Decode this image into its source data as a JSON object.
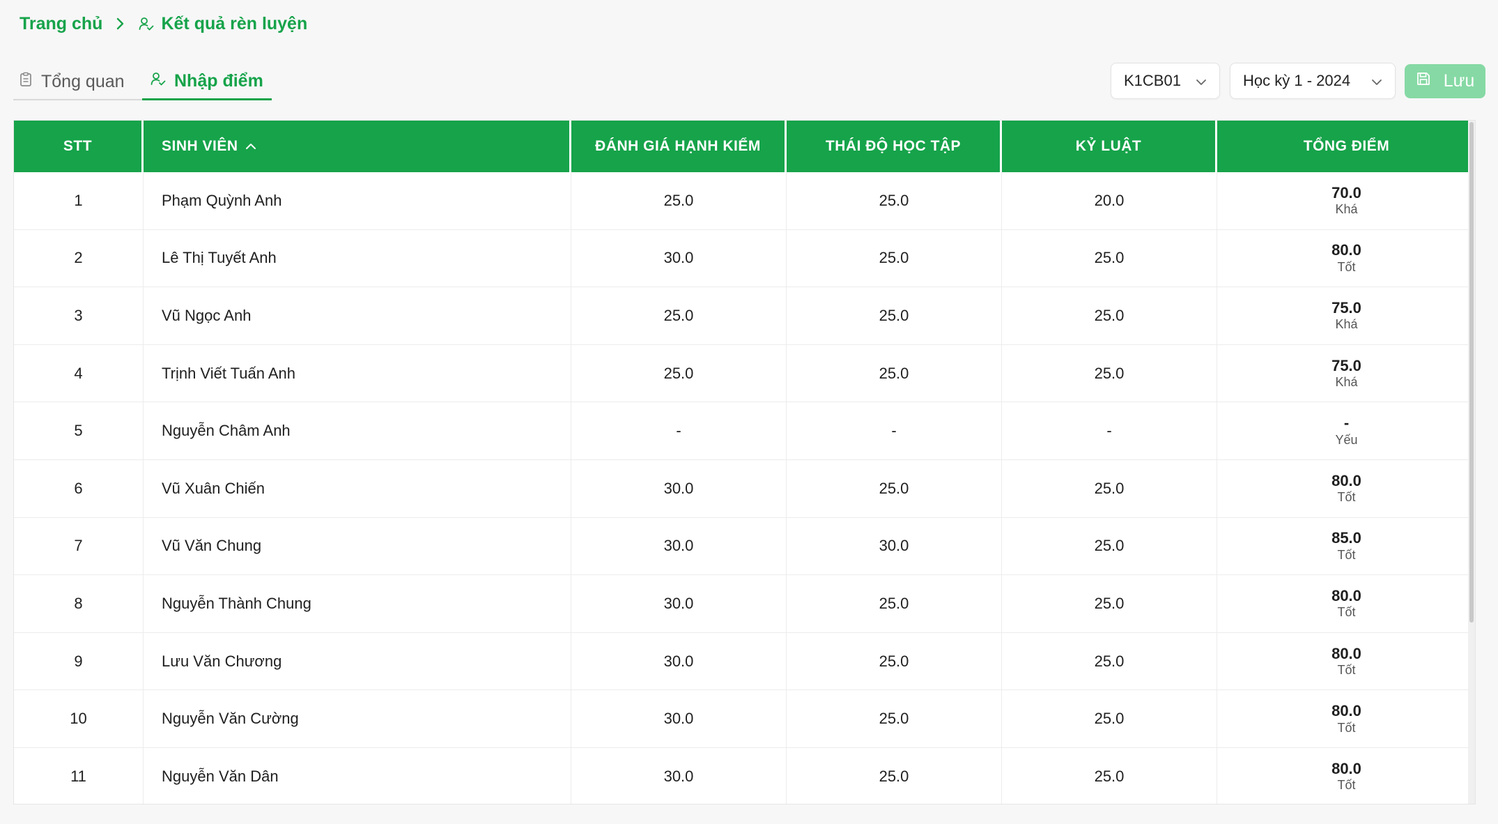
{
  "breadcrumb": {
    "home": "Trang chủ",
    "current": "Kết quả rèn luyện"
  },
  "tabs": [
    {
      "label": "Tổng quan",
      "icon": "clipboard-icon",
      "active": false
    },
    {
      "label": "Nhập điểm",
      "icon": "user-check-icon",
      "active": true
    }
  ],
  "filters": {
    "class": "K1CB01",
    "term": "Học kỳ 1 - 2024"
  },
  "toolbar": {
    "save_label": "Lưu"
  },
  "colors": {
    "accent": "#16a34a",
    "save_disabled": "#86d9a4"
  },
  "table": {
    "headers": {
      "stt": "STT",
      "student": "SINH VIÊN",
      "conduct": "ĐÁNH GIÁ HẠNH KIỂM",
      "attitude": "THÁI ĐỘ HỌC TẬP",
      "discipline": "KỶ LUẬT",
      "total": "TỔNG ĐIỂM"
    },
    "rows": [
      {
        "stt": "1",
        "name": "Phạm Quỳnh Anh",
        "conduct": "25.0",
        "attitude": "25.0",
        "discipline": "20.0",
        "total": "70.0",
        "rank": "Khá"
      },
      {
        "stt": "2",
        "name": "Lê Thị Tuyết Anh",
        "conduct": "30.0",
        "attitude": "25.0",
        "discipline": "25.0",
        "total": "80.0",
        "rank": "Tốt"
      },
      {
        "stt": "3",
        "name": "Vũ Ngọc Anh",
        "conduct": "25.0",
        "attitude": "25.0",
        "discipline": "25.0",
        "total": "75.0",
        "rank": "Khá"
      },
      {
        "stt": "4",
        "name": "Trịnh Viết Tuấn Anh",
        "conduct": "25.0",
        "attitude": "25.0",
        "discipline": "25.0",
        "total": "75.0",
        "rank": "Khá"
      },
      {
        "stt": "5",
        "name": "Nguyễn Châm Anh",
        "conduct": "-",
        "attitude": "-",
        "discipline": "-",
        "total": "-",
        "rank": "Yếu"
      },
      {
        "stt": "6",
        "name": "Vũ Xuân Chiến",
        "conduct": "30.0",
        "attitude": "25.0",
        "discipline": "25.0",
        "total": "80.0",
        "rank": "Tốt"
      },
      {
        "stt": "7",
        "name": "Vũ Văn Chung",
        "conduct": "30.0",
        "attitude": "30.0",
        "discipline": "25.0",
        "total": "85.0",
        "rank": "Tốt"
      },
      {
        "stt": "8",
        "name": "Nguyễn Thành Chung",
        "conduct": "30.0",
        "attitude": "25.0",
        "discipline": "25.0",
        "total": "80.0",
        "rank": "Tốt"
      },
      {
        "stt": "9",
        "name": "Lưu Văn Chương",
        "conduct": "30.0",
        "attitude": "25.0",
        "discipline": "25.0",
        "total": "80.0",
        "rank": "Tốt"
      },
      {
        "stt": "10",
        "name": "Nguyễn Văn Cường",
        "conduct": "30.0",
        "attitude": "25.0",
        "discipline": "25.0",
        "total": "80.0",
        "rank": "Tốt"
      },
      {
        "stt": "11",
        "name": "Nguyễn Văn Dân",
        "conduct": "30.0",
        "attitude": "25.0",
        "discipline": "25.0",
        "total": "80.0",
        "rank": "Tốt"
      }
    ]
  }
}
